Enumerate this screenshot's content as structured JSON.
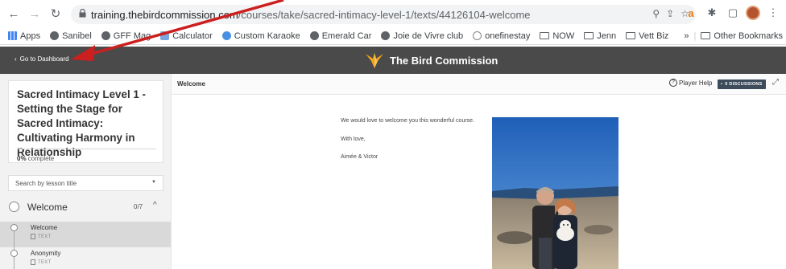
{
  "browser": {
    "url_host": "training.thebirdcommission.com",
    "url_path": "/courses/take/sacred-intimacy-level-1/texts/44126104-welcome",
    "bookmarks": [
      {
        "label": "Apps",
        "icon": "grid-icon"
      },
      {
        "label": "Sanibel",
        "icon": "globe-icon"
      },
      {
        "label": "GFF Mag",
        "icon": "globe-icon"
      },
      {
        "label": "Calculator",
        "icon": "calculator-icon"
      },
      {
        "label": "Custom Karaoke",
        "icon": "cloud-icon"
      },
      {
        "label": "Emerald Car",
        "icon": "globe-icon"
      },
      {
        "label": "Joie de Vivre club",
        "icon": "globe-icon"
      },
      {
        "label": "onefinestay",
        "icon": "onefinestay-icon"
      },
      {
        "label": "NOW",
        "icon": "folder-icon"
      },
      {
        "label": "Jenn",
        "icon": "folder-icon"
      },
      {
        "label": "Vett Biz",
        "icon": "folder-icon"
      }
    ],
    "overflow_label": "»",
    "other_bookmarks": "Other Bookmarks"
  },
  "header": {
    "dashboard_link": "Go to Dashboard",
    "brand": "The Bird Commission",
    "bg_color": "#4a4a4a"
  },
  "sidebar": {
    "course_title": "Sacred Intimacy Level 1 - Setting the Stage for Sacred Intimacy: Cultivating Harmony in Relationship",
    "progress_percent": "0%",
    "progress_suffix": "complete",
    "search_placeholder": "Search by lesson title",
    "chapter": {
      "title": "Welcome",
      "count": "0/7"
    },
    "lessons": [
      {
        "title": "Welcome",
        "type": "TEXT",
        "active": true
      },
      {
        "title": "Anonymity",
        "type": "TEXT",
        "active": false
      }
    ]
  },
  "content": {
    "title": "Welcome",
    "player_help": "Player Help",
    "discussions": "0 DISCUSSIONS",
    "message_lines": [
      "We would love to welcome you this wonderful course.",
      "With love,",
      "Aimée & Victor"
    ]
  },
  "annotation": {
    "arrow_color": "#cc1f1f"
  }
}
